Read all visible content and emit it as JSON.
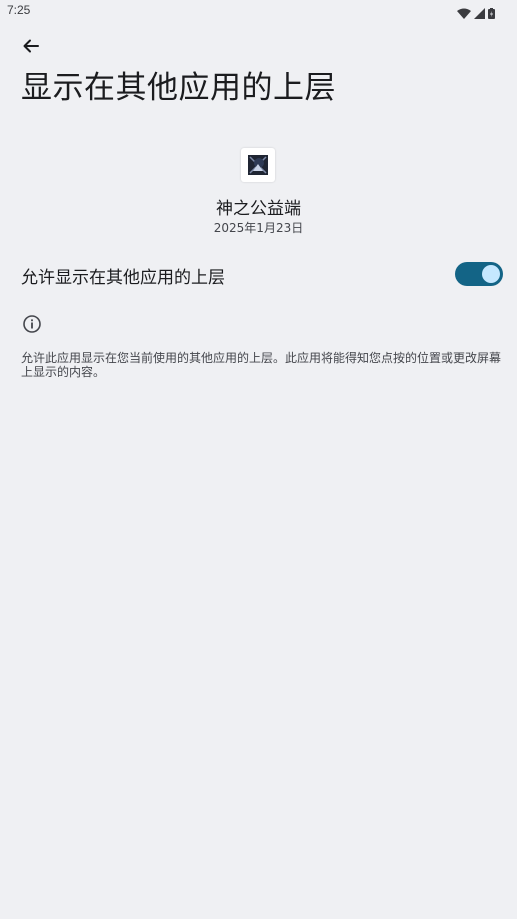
{
  "status_bar": {
    "time": "7:25",
    "icons": [
      "wifi-icon",
      "signal-icon",
      "battery-icon"
    ]
  },
  "header": {
    "back_icon": "arrow-back-icon",
    "title": "显示在其他应用的上层"
  },
  "app": {
    "icon": "app-logo-icon",
    "name": "神之公益端",
    "date": "2025年1月23日"
  },
  "permission": {
    "label": "允许显示在其他应用的上层",
    "enabled": true
  },
  "info": {
    "icon": "info-icon",
    "text": "允许此应用显示在您当前使用的其他应用的上层。此应用将能得知您点按的位置或更改屏幕上显示的内容。"
  },
  "colors": {
    "background": "#eff0f3",
    "switch_track": "#136486",
    "switch_thumb": "#c5e8ff"
  }
}
